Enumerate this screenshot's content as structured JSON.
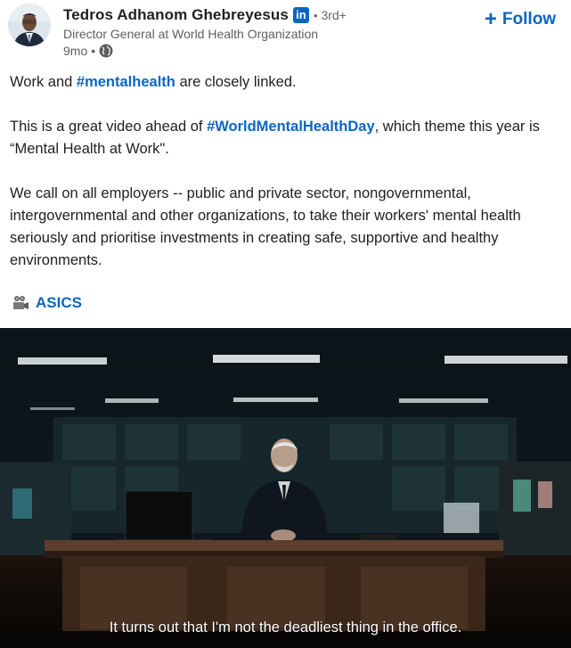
{
  "author": {
    "name": "Tedros Adhanom Ghebreyesus",
    "badge": "in",
    "separator": "•",
    "degree": "3rd+",
    "headline": "Director General at World Health Organization",
    "time": "9mo",
    "visibility_separator": "•",
    "visibility_icon": "globe-icon"
  },
  "follow": {
    "plus": "+",
    "label": "Follow"
  },
  "post": {
    "p1_a": "Work and ",
    "p1_tag": "#mentalhealth",
    "p1_b": " are closely linked.",
    "p2_a": "This is a great video ahead of ",
    "p2_tag": "#WorldMentalHealthDay",
    "p2_b": ", which theme this year is “Mental Health at Work\".",
    "p3": "We call on all employers -- public and private sector, nongovernmental, intergovernmental and other organizations, to take their workers' mental health seriously and prioritise investments in creating safe, supportive and healthy environments.",
    "mention_icon": "movie-camera-icon",
    "mention": "ASICS"
  },
  "video": {
    "subtitle": "It turns out that I'm not the deadliest thing in the office."
  },
  "colors": {
    "brand": "#0a66c2",
    "text": "#1f1f1f",
    "secondary": "#5e5e5e"
  }
}
